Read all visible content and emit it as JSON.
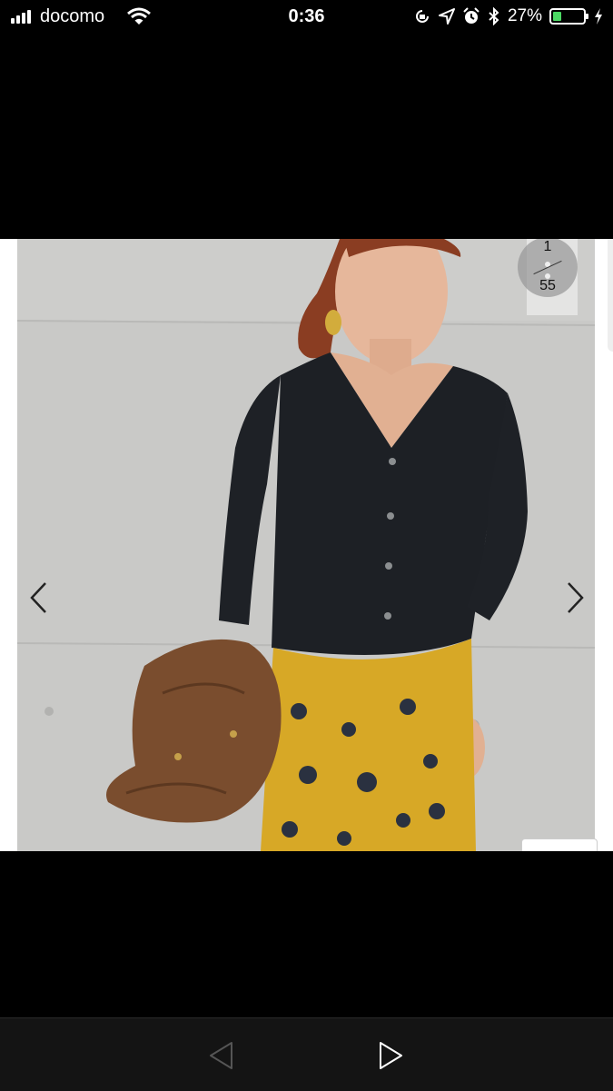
{
  "status_bar": {
    "carrier": "docomo",
    "time": "0:36",
    "battery_percent": "27%",
    "battery_level": 0.27,
    "icons": [
      "signal-icon",
      "wifi-icon",
      "rotation-lock-icon",
      "location-icon",
      "alarm-icon",
      "bluetooth-icon",
      "battery-icon",
      "charging-icon"
    ]
  },
  "viewer": {
    "current_index": "1",
    "total_count": "55",
    "prev_icon": "chevron-left-icon",
    "next_icon": "chevron-right-icon"
  },
  "toolbar": {
    "back_icon": "back-triangle-icon",
    "forward_icon": "forward-triangle-icon"
  },
  "colors": {
    "background": "#000000",
    "battery_fill": "#4cd964",
    "wall": "#c8c8c6",
    "cardigan": "#1d2025",
    "skirt": "#d7a826",
    "jacket": "#7a4d2e"
  }
}
